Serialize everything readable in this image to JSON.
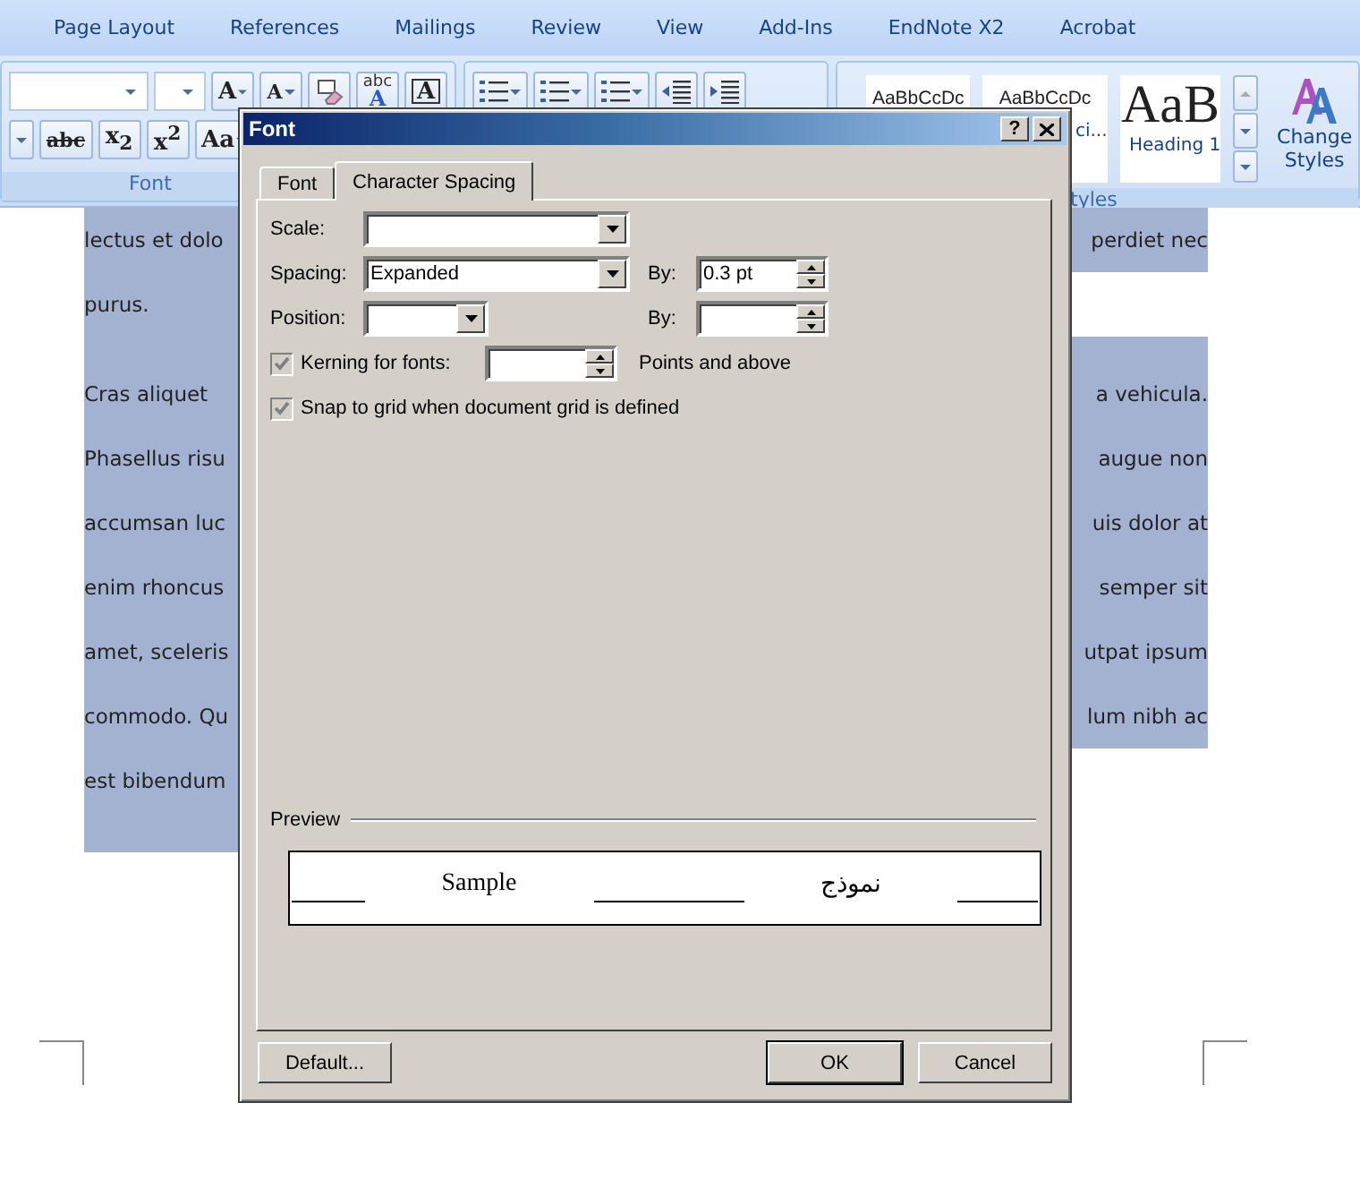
{
  "ribbon_tabs": [
    {
      "label": "Page Layout"
    },
    {
      "label": "References"
    },
    {
      "label": "Mailings"
    },
    {
      "label": "Review"
    },
    {
      "label": "View"
    },
    {
      "label": "Add-Ins"
    },
    {
      "label": "EndNote X2"
    },
    {
      "label": "Acrobat"
    }
  ],
  "font_group": {
    "label": "Font",
    "tools": [
      {
        "kind": "grow",
        "text": "A"
      },
      {
        "kind": "shrink",
        "text": "A"
      },
      {
        "kind": "clear"
      },
      {
        "kind": "phonetic",
        "text": "abc",
        "sub": "A"
      },
      {
        "kind": "border",
        "text": "A"
      }
    ],
    "format_tools": [
      {
        "kind": "strike",
        "text": "abc"
      },
      {
        "kind": "script",
        "text": "x$_{2}$"
      },
      {
        "kind": "script",
        "text": "x$^{2}$"
      },
      {
        "kind": "case",
        "text": "Aa"
      }
    ]
  },
  "styles_group": {
    "label": "tyles",
    "change_styles": "Change Styles",
    "cards": [
      {
        "kind": "normal",
        "sample": "AaBbCcDc"
      },
      {
        "kind": "normal",
        "sample": "AaBbCcDc",
        "name": "ci..."
      },
      {
        "kind": "heading",
        "sample": "AaB",
        "name": "Heading 1"
      }
    ]
  },
  "document": {
    "rows": [
      {
        "left": "lectus et dolo",
        "right": "perdiet nec",
        "full_width_selection": true,
        "gap_before": false
      },
      {
        "left": "purus.",
        "full_width_selection": false,
        "gap_before": false
      },
      {
        "left": "Cras  aliquet",
        "right": "a  vehicula.",
        "full_width_selection": true,
        "gap_before": true
      },
      {
        "left": "Phasellus  risu",
        "right": "augue  non",
        "full_width_selection": true,
        "gap_before": false
      },
      {
        "left": "accumsan luc",
        "right": "uis dolor at",
        "full_width_selection": true,
        "gap_before": false
      },
      {
        "left": "enim rhoncus",
        "right": "semper sit",
        "full_width_selection": true,
        "gap_before": false
      },
      {
        "left": "amet, sceleris",
        "right": "utpat ipsum",
        "full_width_selection": true,
        "gap_before": false
      },
      {
        "left": "commodo. Qu",
        "right": "lum nibh ac",
        "full_width_selection": true,
        "gap_before": false
      },
      {
        "left": "est bibendum",
        "full_width_selection": false,
        "gap_before": false
      }
    ]
  },
  "dialog": {
    "title": "Font",
    "help": "?",
    "tabs": [
      {
        "label": "Font",
        "selected": false
      },
      {
        "label": "Character Spacing",
        "selected": true
      }
    ],
    "rows": [
      {
        "label": "Scale:",
        "field": {
          "kind": "dropdown"
        }
      },
      {
        "label": "Spacing:",
        "field": {
          "kind": "dropdown",
          "value": "Expanded"
        },
        "by": {
          "label": "By:",
          "value": "0.3 pt"
        }
      },
      {
        "label": "Position:",
        "field": {
          "kind": "short_dropdown"
        },
        "by": {
          "label": "By:"
        }
      }
    ],
    "checkboxes": [
      {
        "label": "Kerning for fonts:",
        "checked": true,
        "disabled": true,
        "kind": "spinner",
        "suffix": "Points and above"
      },
      {
        "label": "Snap to grid when document grid is defined",
        "checked": true,
        "disabled": true,
        "kind": "plain"
      }
    ],
    "preview": {
      "legend": "Preview",
      "sample": "Sample",
      "sample_rtl": "نموذج"
    },
    "buttons": [
      {
        "label": "Default...",
        "kind": "left"
      },
      {
        "label": "OK",
        "kind": "default"
      },
      {
        "label": "Cancel",
        "kind": "normal"
      }
    ]
  }
}
